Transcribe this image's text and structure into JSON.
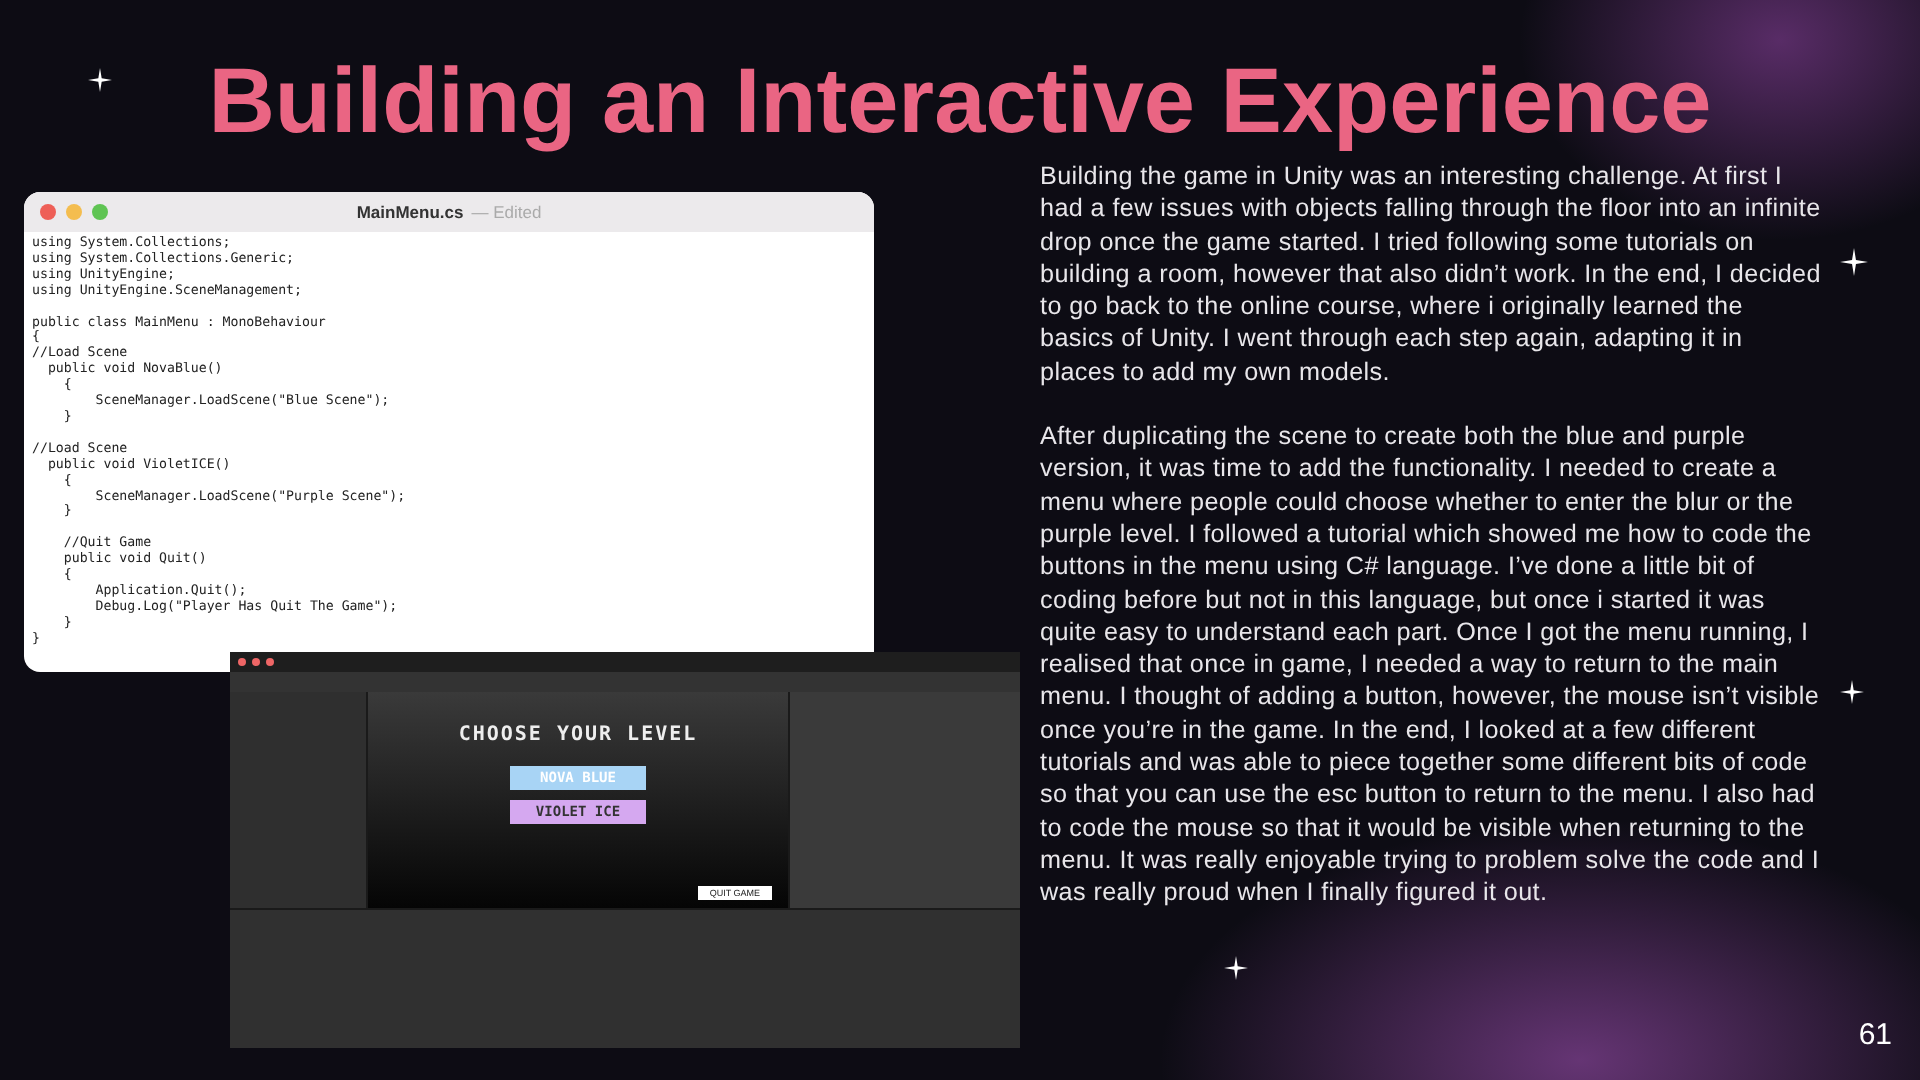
{
  "title": "Building an Interactive Experience",
  "code_window": {
    "file_name": "MainMenu.cs",
    "status": "— Edited",
    "code": "using System.Collections;\nusing System.Collections.Generic;\nusing UnityEngine;\nusing UnityEngine.SceneManagement;\n\npublic class MainMenu : MonoBehaviour\n{\n//Load Scene\n  public void NovaBlue()\n    {\n        SceneManager.LoadScene(\"Blue Scene\");\n    }\n\n//Load Scene\n  public void VioletICE()\n    {\n        SceneManager.LoadScene(\"Purple Scene\");\n    }\n\n    //Quit Game\n    public void Quit()\n    {\n        Application.Quit();\n        Debug.Log(\"Player Has Quit The Game\");\n    }\n}"
  },
  "unity_window": {
    "game_view": {
      "heading": "CHOOSE YOUR LEVEL",
      "buttons": [
        {
          "label": "NOVA BLUE",
          "color": "#a8d4f5"
        },
        {
          "label": "VIOLET ICE",
          "color": "#d5a8f0"
        }
      ],
      "quit_label": "QUIT GAME"
    }
  },
  "paragraphs": [
    "Building the game in Unity was an interesting challenge. At first I had a few issues with objects falling through the floor into an infinite drop once the game started. I tried following some tutorials on building a room, however that also didn’t work. In the end, I decided to go back to the online course, where i originally learned the basics of Unity. I went through each step again, adapting it in places to add my own models.",
    "After duplicating the scene to create both the blue and purple version, it was time to add the functionality. I needed to create a menu where people could choose whether to enter the blur or the purple level. I followed a tutorial which showed me how to code the buttons in the menu using C# language. I’ve done a little bit of coding before but not in this language, but once i started it was quite easy to understand each part. Once I got the menu running, I realised that once in game, I needed a way to return to the main menu. I thought of adding a button, however, the mouse isn’t visible once you’re in the game. In the end, I looked at a few different tutorials and was able to piece together some different bits of code so that you can use the esc button to return to the menu. I also had to code the mouse so that it would be visible when returning to the menu. It was really enjoyable trying to problem solve the code and I was really proud when I finally figured it out."
  ],
  "page_number": "61"
}
